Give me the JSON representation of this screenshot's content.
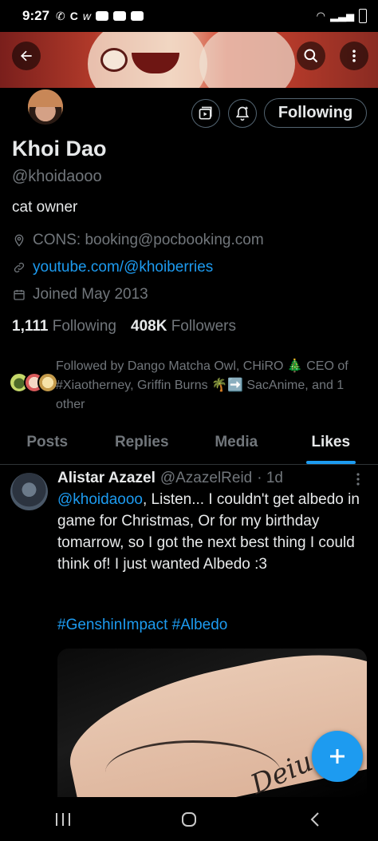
{
  "status_bar": {
    "time": "9:27",
    "battery_label": ""
  },
  "profile": {
    "display_name": "Khoi Dao",
    "handle": "@khoidaooo",
    "bio": "cat owner",
    "professional_category": "CONS: booking@pocbooking.com",
    "website": "youtube.com/@khoiberries",
    "joined": "Joined May 2013",
    "following_count": "1,111",
    "following_label": "Following",
    "followers_count": "408K",
    "followers_label": "Followers",
    "followed_by": "Followed by Dango Matcha Owl, CHiRO 🎄 CEO of #Xiaotherney, Griffin Burns 🌴➡️ SacAnime, and 1 other",
    "follow_button_label": "Following"
  },
  "tabs": [
    {
      "label": "Posts",
      "active": false
    },
    {
      "label": "Replies",
      "active": false
    },
    {
      "label": "Media",
      "active": false
    },
    {
      "label": "Likes",
      "active": true
    }
  ],
  "tweet": {
    "display_name": "Alistar Azazel",
    "handle": "@AzazelReid",
    "time": "· 1d",
    "mention": "@khoidaooo",
    "body": ", Listen... I couldn't get albedo in game for Christmas, Or for my birthday tomarrow, so I got the next best thing I could think of! I just wanted Albedo :3",
    "hashtags": "#GenshinImpact #Albedo"
  },
  "colors": {
    "accent": "#1d9bf0",
    "text": "#e7e9ea",
    "muted": "#71767b",
    "background": "#000000"
  },
  "icons": [
    "back-arrow-icon",
    "search-icon",
    "more-vertical-icon",
    "subscribe-icon",
    "notification-bell-icon",
    "location-icon",
    "link-icon",
    "calendar-icon",
    "compose-plus-icon",
    "recents-icon",
    "home-icon",
    "back-chevron-icon"
  ]
}
